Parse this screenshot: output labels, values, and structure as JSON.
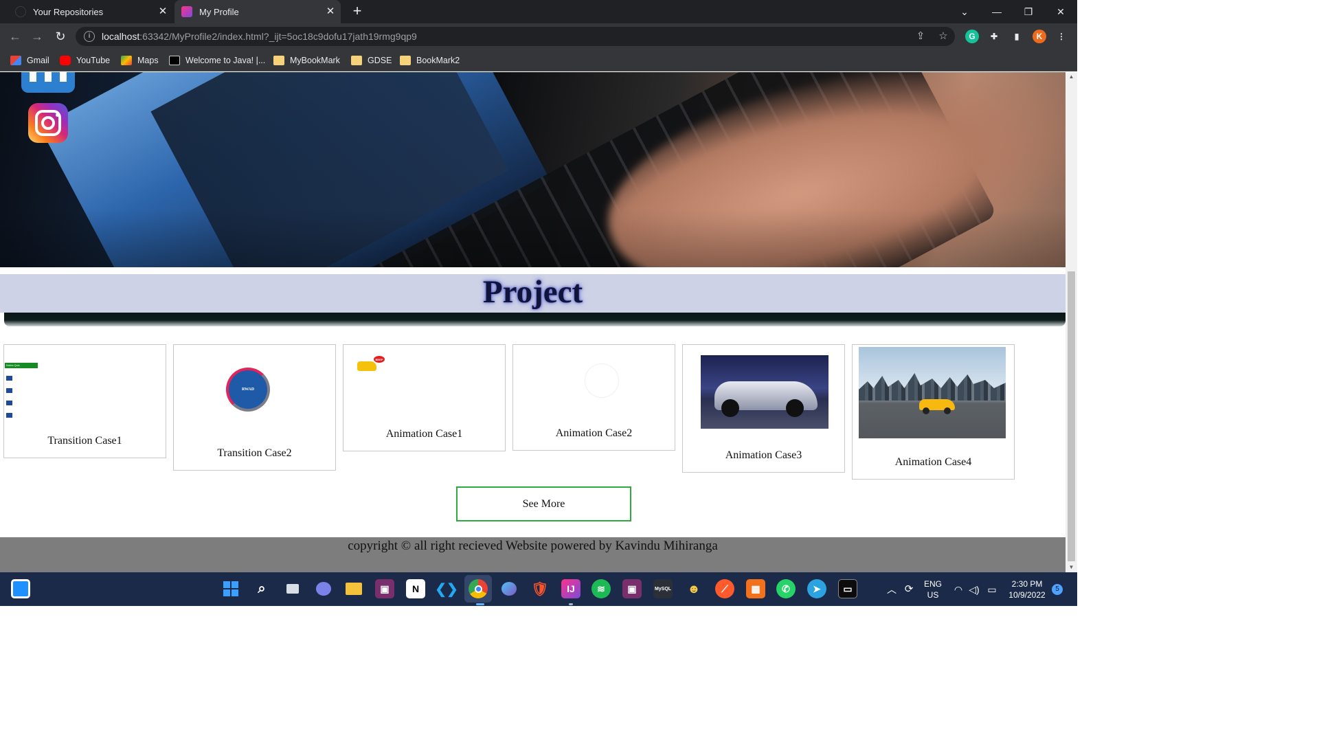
{
  "browser": {
    "tabs": [
      {
        "title": "Your Repositories",
        "active": false
      },
      {
        "title": "My Profile",
        "active": true
      }
    ],
    "url": {
      "host": "localhost",
      "rest": ":63342/MyProfile2/index.html?_ijt=5oc18c9dofu17jath19rmg9qp9"
    },
    "profile_initial": "K",
    "bookmarks": [
      {
        "label": "Gmail",
        "icon": "gmail-icon"
      },
      {
        "label": "YouTube",
        "icon": "youtube-icon"
      },
      {
        "label": "Maps",
        "icon": "maps-icon"
      },
      {
        "label": "Welcome to Java! |...",
        "icon": "jetbrains-icon"
      },
      {
        "label": "MyBookMark",
        "icon": "folder-icon"
      },
      {
        "label": "GDSE",
        "icon": "folder-icon"
      },
      {
        "label": "BookMark2",
        "icon": "folder-icon"
      }
    ]
  },
  "page": {
    "section_title": "Project",
    "cards": [
      {
        "label": "Transition Case1",
        "thumb_text": "Notes Quic"
      },
      {
        "label": "Transition Case2",
        "thumb_text": "RWAD"
      },
      {
        "label": "Animation Case1",
        "thumb_text": "BEEP"
      },
      {
        "label": "Animation Case2"
      },
      {
        "label": "Animation Case3"
      },
      {
        "label": "Animation Case4"
      }
    ],
    "see_more_label": "See More",
    "footer_text": "copyright © all right recieved Website powered by Kavindu Mihiranga"
  },
  "taskbar": {
    "lang_top": "ENG",
    "lang_bottom": "US",
    "time": "2:30 PM",
    "date": "10/9/2022",
    "notification_count": "5"
  },
  "colors": {
    "accent_green": "#2eaa3f",
    "project_band": "#cdd2e6",
    "footer_bg": "#7d7d7d",
    "taskbar_bg": "#1c2a4a"
  }
}
